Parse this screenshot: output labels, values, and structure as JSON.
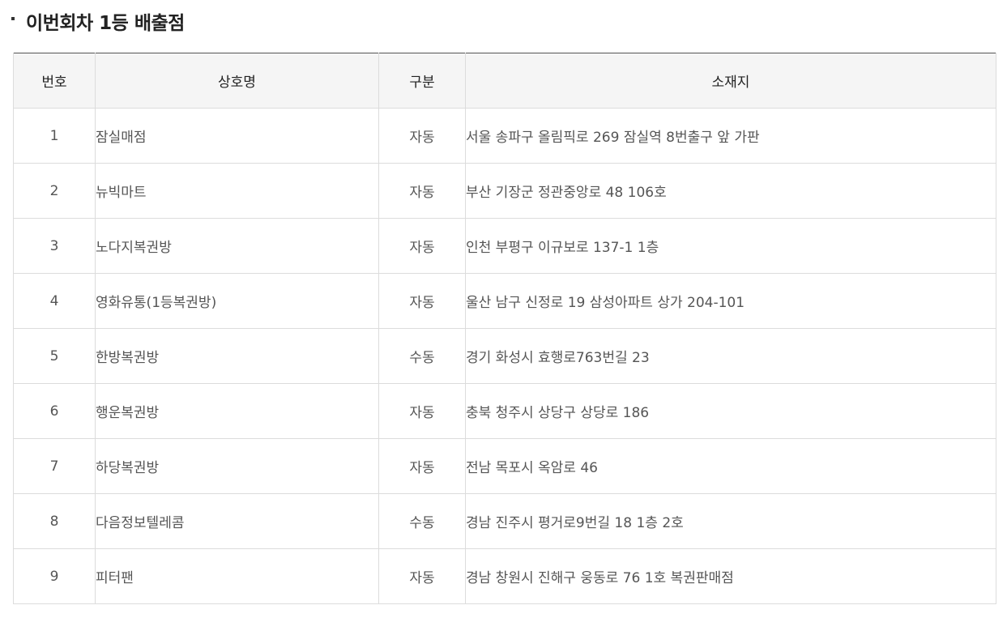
{
  "section": {
    "title": "이번회차 1등 배출점"
  },
  "table": {
    "headers": {
      "no": "번호",
      "name": "상호명",
      "type": "구분",
      "address": "소재지"
    },
    "rows": [
      {
        "no": "1",
        "name": "잠실매점",
        "type": "자동",
        "address": "서울 송파구 올림픽로 269 잠실역 8번출구 앞 가판"
      },
      {
        "no": "2",
        "name": "뉴빅마트",
        "type": "자동",
        "address": "부산 기장군 정관중앙로 48 106호"
      },
      {
        "no": "3",
        "name": "노다지복권방",
        "type": "자동",
        "address": "인천 부평구 이규보로 137-1 1층"
      },
      {
        "no": "4",
        "name": "영화유통(1등복권방)",
        "type": "자동",
        "address": "울산 남구 신정로 19 삼성아파트 상가 204-101"
      },
      {
        "no": "5",
        "name": "한방복권방",
        "type": "수동",
        "address": "경기 화성시 효행로763번길 23"
      },
      {
        "no": "6",
        "name": "행운복권방",
        "type": "자동",
        "address": "충북 청주시 상당구 상당로 186"
      },
      {
        "no": "7",
        "name": "하당복권방",
        "type": "자동",
        "address": "전남 목포시 옥암로 46"
      },
      {
        "no": "8",
        "name": "다음정보텔레콤",
        "type": "수동",
        "address": "경남 진주시 평거로9번길 18 1층 2호"
      },
      {
        "no": "9",
        "name": "피터팬",
        "type": "자동",
        "address": "경남 창원시 진해구 웅동로 76 1호 복권판매점"
      }
    ]
  }
}
